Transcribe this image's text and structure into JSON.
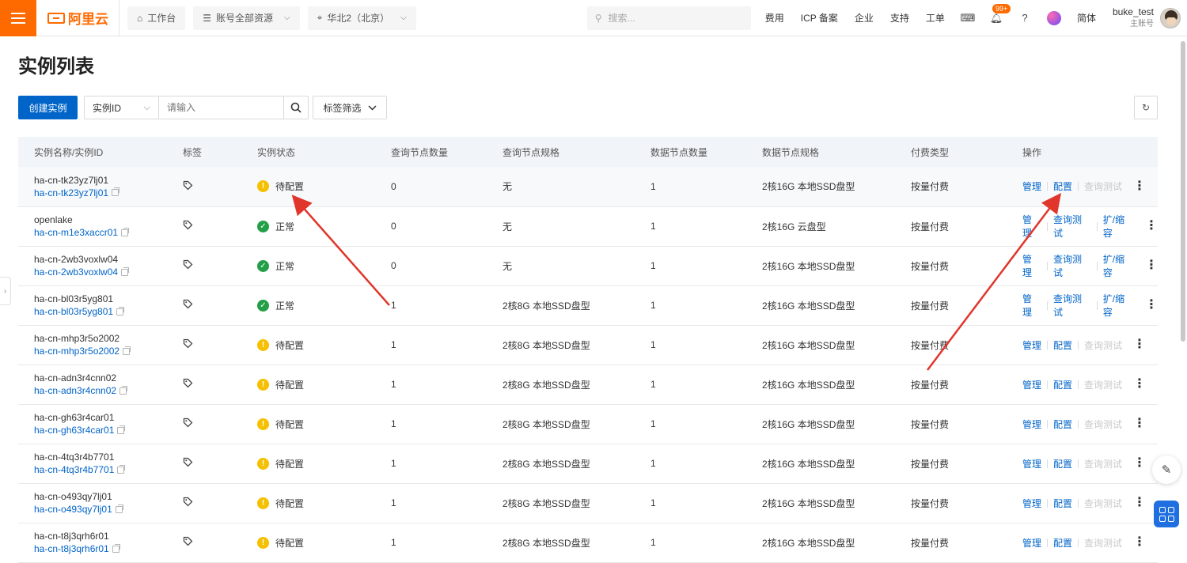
{
  "topbar": {
    "logo_text": "阿里云",
    "workspace_label": "工作台",
    "resources_label": "账号全部资源",
    "region_label": "华北2（北京）",
    "search_placeholder": "搜索...",
    "links": [
      "费用",
      "ICP 备案",
      "企业",
      "支持",
      "工单"
    ],
    "notification_badge": "99+",
    "language_label": "简体",
    "user_name": "buke_test",
    "user_role": "主账号"
  },
  "page": {
    "title": "实例列表",
    "create_button": "创建实例",
    "filter_field": "实例ID",
    "filter_placeholder": "请输入",
    "tag_filter_label": "标签筛选"
  },
  "table": {
    "headers": [
      "实例名称/实例ID",
      "标签",
      "实例状态",
      "查询节点数量",
      "查询节点规格",
      "数据节点数量",
      "数据节点规格",
      "付费类型",
      "操作"
    ],
    "rows": [
      {
        "name": "ha-cn-tk23yz7lj01",
        "id": "ha-cn-tk23yz7lj01",
        "status": "待配置",
        "status_type": "warn",
        "query_nodes": "0",
        "query_spec": "无",
        "data_nodes": "1",
        "data_spec": "2核16G 本地SSD盘型",
        "billing": "按量付费",
        "actions": [
          "管理",
          "配置",
          "查询测试"
        ],
        "disabled": [
          false,
          false,
          true
        ]
      },
      {
        "name": "openlake",
        "id": "ha-cn-m1e3xaccr01",
        "status": "正常",
        "status_type": "ok",
        "query_nodes": "0",
        "query_spec": "无",
        "data_nodes": "1",
        "data_spec": "2核16G 云盘型",
        "billing": "按量付费",
        "actions": [
          "管理",
          "查询测试",
          "扩/缩容"
        ],
        "disabled": [
          false,
          false,
          false
        ]
      },
      {
        "name": "ha-cn-2wb3voxlw04",
        "id": "ha-cn-2wb3voxlw04",
        "status": "正常",
        "status_type": "ok",
        "query_nodes": "0",
        "query_spec": "无",
        "data_nodes": "1",
        "data_spec": "2核16G 本地SSD盘型",
        "billing": "按量付费",
        "actions": [
          "管理",
          "查询测试",
          "扩/缩容"
        ],
        "disabled": [
          false,
          false,
          false
        ]
      },
      {
        "name": "ha-cn-bl03r5yg801",
        "id": "ha-cn-bl03r5yg801",
        "status": "正常",
        "status_type": "ok",
        "query_nodes": "1",
        "query_spec": "2核8G 本地SSD盘型",
        "data_nodes": "1",
        "data_spec": "2核16G 本地SSD盘型",
        "billing": "按量付费",
        "actions": [
          "管理",
          "查询测试",
          "扩/缩容"
        ],
        "disabled": [
          false,
          false,
          false
        ]
      },
      {
        "name": "ha-cn-mhp3r5o2002",
        "id": "ha-cn-mhp3r5o2002",
        "status": "待配置",
        "status_type": "warn",
        "query_nodes": "1",
        "query_spec": "2核8G 本地SSD盘型",
        "data_nodes": "1",
        "data_spec": "2核16G 本地SSD盘型",
        "billing": "按量付费",
        "actions": [
          "管理",
          "配置",
          "查询测试"
        ],
        "disabled": [
          false,
          false,
          true
        ]
      },
      {
        "name": "ha-cn-adn3r4cnn02",
        "id": "ha-cn-adn3r4cnn02",
        "status": "待配置",
        "status_type": "warn",
        "query_nodes": "1",
        "query_spec": "2核8G 本地SSD盘型",
        "data_nodes": "1",
        "data_spec": "2核16G 本地SSD盘型",
        "billing": "按量付费",
        "actions": [
          "管理",
          "配置",
          "查询测试"
        ],
        "disabled": [
          false,
          false,
          true
        ]
      },
      {
        "name": "ha-cn-gh63r4car01",
        "id": "ha-cn-gh63r4car01",
        "status": "待配置",
        "status_type": "warn",
        "query_nodes": "1",
        "query_spec": "2核8G 本地SSD盘型",
        "data_nodes": "1",
        "data_spec": "2核16G 本地SSD盘型",
        "billing": "按量付费",
        "actions": [
          "管理",
          "配置",
          "查询测试"
        ],
        "disabled": [
          false,
          false,
          true
        ]
      },
      {
        "name": "ha-cn-4tq3r4b7701",
        "id": "ha-cn-4tq3r4b7701",
        "status": "待配置",
        "status_type": "warn",
        "query_nodes": "1",
        "query_spec": "2核8G 本地SSD盘型",
        "data_nodes": "1",
        "data_spec": "2核16G 本地SSD盘型",
        "billing": "按量付费",
        "actions": [
          "管理",
          "配置",
          "查询测试"
        ],
        "disabled": [
          false,
          false,
          true
        ]
      },
      {
        "name": "ha-cn-o493qy7lj01",
        "id": "ha-cn-o493qy7lj01",
        "status": "待配置",
        "status_type": "warn",
        "query_nodes": "1",
        "query_spec": "2核8G 本地SSD盘型",
        "data_nodes": "1",
        "data_spec": "2核16G 本地SSD盘型",
        "billing": "按量付费",
        "actions": [
          "管理",
          "配置",
          "查询测试"
        ],
        "disabled": [
          false,
          false,
          true
        ]
      },
      {
        "name": "ha-cn-t8j3qrh6r01",
        "id": "ha-cn-t8j3qrh6r01",
        "status": "待配置",
        "status_type": "warn",
        "query_nodes": "1",
        "query_spec": "2核8G 本地SSD盘型",
        "data_nodes": "1",
        "data_spec": "2核16G 本地SSD盘型",
        "billing": "按量付费",
        "actions": [
          "管理",
          "配置",
          "查询测试"
        ],
        "disabled": [
          false,
          false,
          true
        ]
      }
    ]
  },
  "colors": {
    "brand": "#ff6a00",
    "primary": "#0064c8",
    "status_ok": "#23a047",
    "status_warn": "#f5c000",
    "annotation_arrow": "#e0362b"
  }
}
